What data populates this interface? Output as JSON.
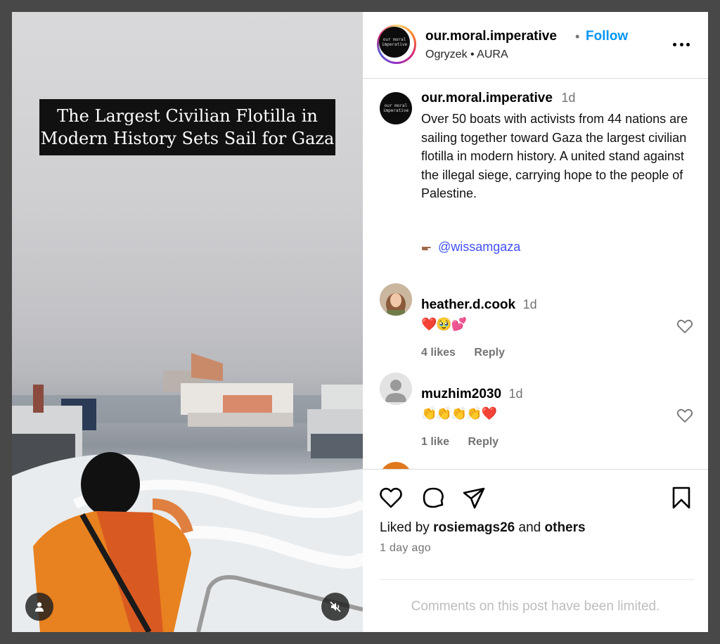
{
  "media": {
    "overlay_title_lines": [
      "The Largest Civilian Flotilla in",
      "Modern History Sets Sail for Gaza"
    ],
    "user_button_icon": "user-icon",
    "mute_button_icon": "muted-speaker-icon"
  },
  "header": {
    "avatar_text": "our moral imperative",
    "username": "our.moral.imperative",
    "separator": "•",
    "follow_label": "Follow",
    "audio": "Ogryzek • AURA",
    "more_icon": "more-horizontal-icon"
  },
  "caption": {
    "avatar_text": "our moral imperative",
    "username": "our.moral.imperative",
    "time": "1d",
    "text": "Over 50 boats with activists from 44 nations are sailing together toward Gaza the largest civilian flotilla in modern history. A united stand against the illegal siege, carrying hope to the people of Palestine.",
    "mention": "@wissamgaza"
  },
  "comments": [
    {
      "username": "heather.d.cook",
      "time": "1d",
      "text": "❤️🥹💕",
      "likes": "4 likes",
      "reply_label": "Reply"
    },
    {
      "username": "muzhim2030",
      "time": "1d",
      "text": "👏👏👏👏❤️",
      "likes": "1 like",
      "reply_label": "Reply"
    }
  ],
  "actions": {
    "icons": [
      "heart-icon",
      "comment-icon",
      "share-icon",
      "bookmark-icon"
    ],
    "liked_prefix": "Liked by",
    "liked_user": "rosiemags26",
    "liked_and": "and",
    "liked_others": "others",
    "time_ago": "1 day ago",
    "limited_notice": "Comments on this post have been limited."
  },
  "colors": {
    "follow": "#0095f6",
    "mention": "#4150f7",
    "muted_text": "#737373"
  }
}
